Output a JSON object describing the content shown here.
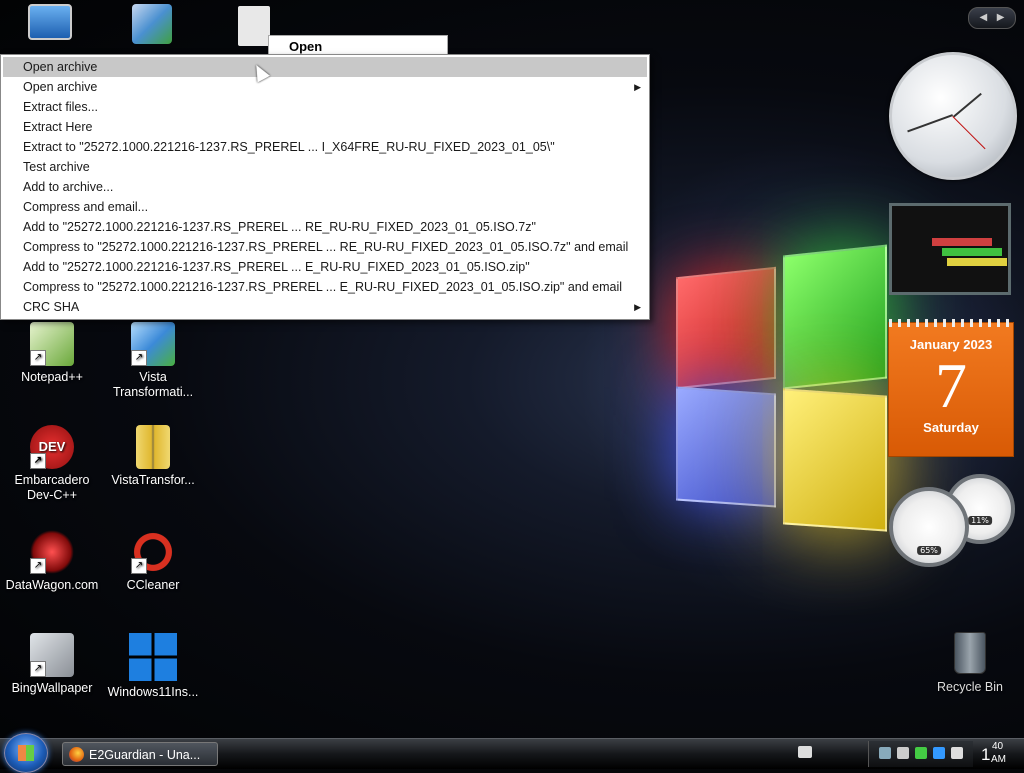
{
  "popup_top": {
    "label": "Open"
  },
  "context_menu": {
    "items": [
      {
        "label": "Open archive",
        "highlighted": true,
        "submenu": false
      },
      {
        "label": "Open archive",
        "highlighted": false,
        "submenu": true
      },
      {
        "label": "Extract files...",
        "highlighted": false,
        "submenu": false
      },
      {
        "label": "Extract Here",
        "highlighted": false,
        "submenu": false
      },
      {
        "label": "Extract to \"25272.1000.221216-1237.RS_PREREL ... I_X64FRE_RU-RU_FIXED_2023_01_05\\\"",
        "highlighted": false,
        "submenu": false
      },
      {
        "label": "Test archive",
        "highlighted": false,
        "submenu": false
      },
      {
        "label": "Add to archive...",
        "highlighted": false,
        "submenu": false
      },
      {
        "label": "Compress and email...",
        "highlighted": false,
        "submenu": false
      },
      {
        "label": "Add to \"25272.1000.221216-1237.RS_PREREL ... RE_RU-RU_FIXED_2023_01_05.ISO.7z\"",
        "highlighted": false,
        "submenu": false
      },
      {
        "label": "Compress to \"25272.1000.221216-1237.RS_PREREL ... RE_RU-RU_FIXED_2023_01_05.ISO.7z\" and email",
        "highlighted": false,
        "submenu": false
      },
      {
        "label": "Add to \"25272.1000.221216-1237.RS_PREREL ... E_RU-RU_FIXED_2023_01_05.ISO.zip\"",
        "highlighted": false,
        "submenu": false
      },
      {
        "label": "Compress to \"25272.1000.221216-1237.RS_PREREL ... E_RU-RU_FIXED_2023_01_05.ISO.zip\" and email",
        "highlighted": false,
        "submenu": false
      },
      {
        "label": "CRC SHA",
        "highlighted": false,
        "submenu": true
      }
    ],
    "submenu_arrow": "▶"
  },
  "desktop_icons": [
    {
      "name": "notepad-plus-plus",
      "label": "Notepad++",
      "icon": "notepad-icon",
      "color": "#6aa83a"
    },
    {
      "name": "vista-transformation",
      "label": "Vista Transformati...",
      "icon": "vista-icon",
      "color": "#3c8ad8"
    },
    {
      "name": "embarcadero-dev-cpp",
      "label": "Embarcadero Dev-C++",
      "icon": "dev-cpp-icon",
      "color": "#c81a1a",
      "badge": "DEV"
    },
    {
      "name": "vistatransfor-zip",
      "label": "VistaTransfor...",
      "icon": "zip-folder-icon",
      "color": "#e8c84a"
    },
    {
      "name": "datawagon",
      "label": "DataWagon.com",
      "icon": "datawagon-icon",
      "color": "#a01818"
    },
    {
      "name": "ccleaner",
      "label": "CCleaner",
      "icon": "ccleaner-icon",
      "color": "#d83020"
    },
    {
      "name": "bingwallpaper",
      "label": "BingWallpaper",
      "icon": "bing-icon",
      "color": "#8a8f96"
    },
    {
      "name": "windows11-installer",
      "label": "Windows11Ins...",
      "icon": "windows-logo-icon",
      "color": "#1e7fe0"
    }
  ],
  "gadgets": {
    "nav_left": "◀",
    "nav_right": "▶",
    "calendar": {
      "month": "January 2023",
      "day": "7",
      "weekday": "Saturday"
    },
    "cpu_meter": {
      "cpu": "65%",
      "mem": "11%"
    }
  },
  "recycle_bin": {
    "label": "Recycle Bin"
  },
  "taskbar": {
    "task_label": "E2Guardian - Una...",
    "clock_hour": "1",
    "clock_minute": "40",
    "clock_ampm": "AM"
  }
}
